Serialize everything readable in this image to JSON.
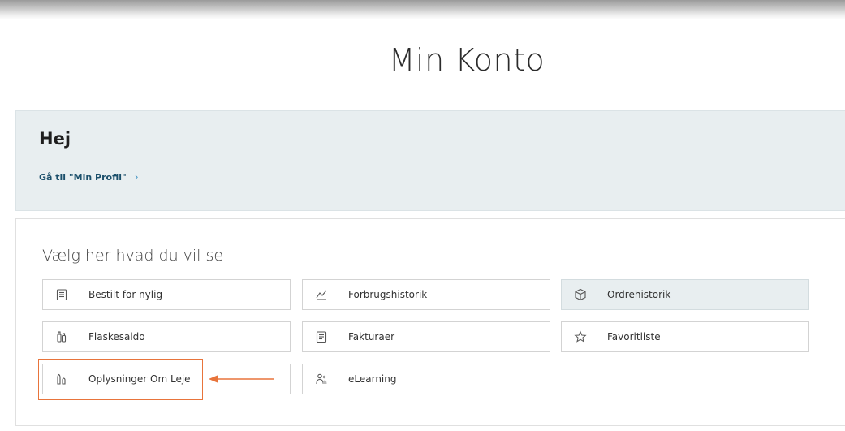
{
  "page": {
    "title": "Min Konto"
  },
  "greeting": {
    "title": "Hej",
    "profile_link": "Gå til \"Min Profil\"",
    "chevron": "›"
  },
  "choices": {
    "heading": "Vælg her hvad du vil se",
    "tiles": [
      {
        "label": "Bestilt for nylig",
        "icon": "list-icon",
        "selected": false
      },
      {
        "label": "Forbrugshistorik",
        "icon": "chart-icon",
        "selected": false
      },
      {
        "label": "Ordrehistorik",
        "icon": "box-icon",
        "selected": true
      },
      {
        "label": "Flaskesaldo",
        "icon": "bottles-icon",
        "selected": false
      },
      {
        "label": "Fakturaer",
        "icon": "invoice-icon",
        "selected": false
      },
      {
        "label": "Favoritliste",
        "icon": "star-icon",
        "selected": false
      },
      {
        "label": "Oplysninger Om Leje",
        "icon": "rental-icon",
        "selected": false
      },
      {
        "label": "eLearning",
        "icon": "people-icon",
        "selected": false
      }
    ]
  },
  "colors": {
    "panel_bg": "#e8eef0",
    "link": "#1b4f6b",
    "annotation": "#e8743b"
  }
}
